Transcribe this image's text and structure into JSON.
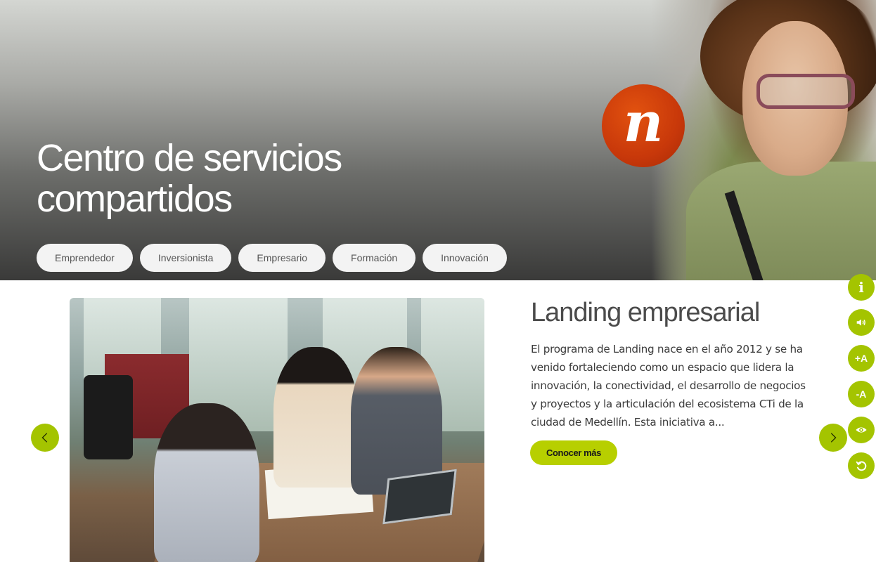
{
  "hero": {
    "title": "Centro de servicios compartidos",
    "logo_letter": "n",
    "logo_color": "#c8380a",
    "categories": [
      "Emprendedor",
      "Inversionista",
      "Empresario",
      "Formación",
      "Innovación"
    ]
  },
  "slider": {
    "title": "Landing empresarial",
    "description": "El programa de Landing nace en el año 2012 y se ha venido fortaleciendo como un espacio que lidera la innovación, la conectividad, el desarrollo de negocios y proyectos y la articulación del ecosistema CTi de la ciudad de Medellín. Esta iniciativa a...",
    "cta_label": "Conocer más",
    "prev_icon": "chevron-left-icon",
    "next_icon": "chevron-right-icon",
    "accent_color": "#a4c400"
  },
  "accessibility_toolbar": {
    "buttons": [
      {
        "icon": "info-icon",
        "label": "i"
      },
      {
        "icon": "speaker-icon",
        "label": ""
      },
      {
        "icon": "increase-text-icon",
        "label": "+A"
      },
      {
        "icon": "decrease-text-icon",
        "label": "-A"
      },
      {
        "icon": "eye-icon",
        "label": ""
      },
      {
        "icon": "reset-icon",
        "label": ""
      }
    ]
  }
}
